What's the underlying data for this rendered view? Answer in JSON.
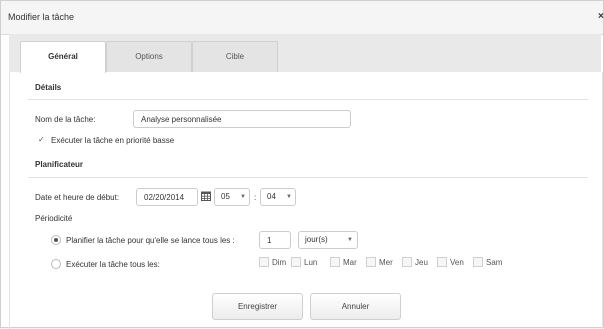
{
  "dialog": {
    "title": "Modifier la tâche",
    "close_glyph": "×"
  },
  "tabs": [
    {
      "label": "Général",
      "active": true
    },
    {
      "label": "Options",
      "active": false
    },
    {
      "label": "Cible",
      "active": false
    }
  ],
  "details": {
    "heading": "Détails",
    "task_name_label": "Nom de la tâche:",
    "task_name_value": "Analyse personnalisée",
    "low_priority_label": "Exécuter la tâche en priorité basse",
    "low_priority_checked": true,
    "check_glyph": "✓"
  },
  "scheduler": {
    "heading": "Planificateur",
    "start_label": "Date et heure de début:",
    "start_date": "02/20/2014",
    "hour": "05",
    "minute": "04",
    "time_separator": ":",
    "periodicity_label": "Périodicité",
    "option_interval_label": "Planifier la tâche pour qu'elle se lance tous les :",
    "interval_value": "1",
    "interval_unit": "jour(s)",
    "option_days_label": "Exécuter la tâche tous les:",
    "selected_option": "interval",
    "days": [
      "Dim",
      "Lun",
      "Mar",
      "Mer",
      "Jeu",
      "Ven",
      "Sam"
    ]
  },
  "buttons": {
    "save": "Enregistrer",
    "cancel": "Annuler"
  },
  "icons": {
    "calendar": "calendar-icon",
    "close": "close-icon",
    "dropdown": "caret-down-icon"
  }
}
